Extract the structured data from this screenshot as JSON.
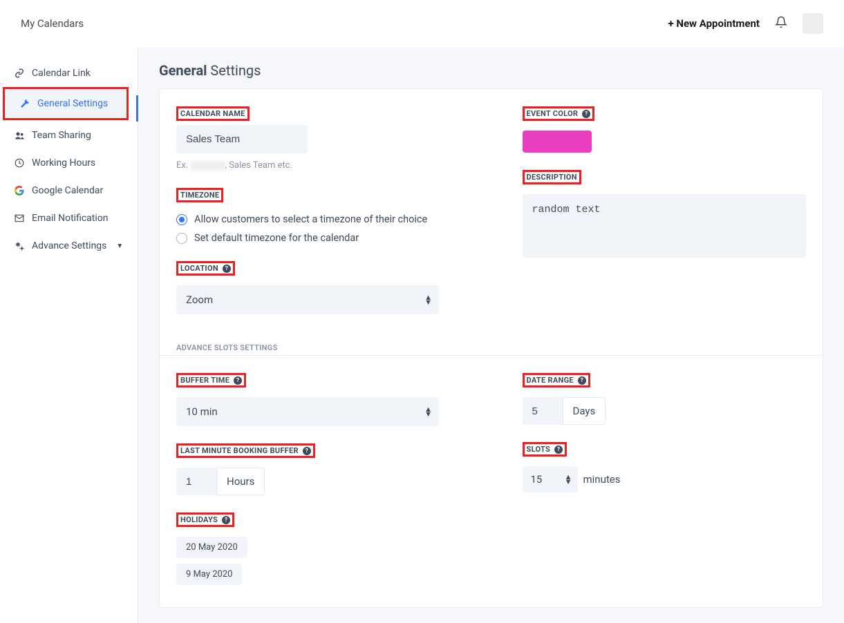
{
  "topbar": {
    "title": "My Calendars",
    "new_appointment_label": "+ New Appointment"
  },
  "sidebar": {
    "items": [
      {
        "label": "Calendar Link",
        "icon": "link-icon"
      },
      {
        "label": "General Settings",
        "icon": "wrench-icon",
        "active": true
      },
      {
        "label": "Team Sharing",
        "icon": "users-icon"
      },
      {
        "label": "Working Hours",
        "icon": "clock-icon"
      },
      {
        "label": "Google Calendar",
        "icon": "google-icon"
      },
      {
        "label": "Email Notification",
        "icon": "mail-icon"
      },
      {
        "label": "Advance Settings",
        "icon": "gears-icon",
        "has_submenu": true
      }
    ]
  },
  "page": {
    "title_strong": "General",
    "title_rest": " Settings"
  },
  "form": {
    "calendar_name": {
      "label": "CALENDAR NAME",
      "value": "Sales Team",
      "hint_prefix": "Ex. ",
      "hint_suffix": ", Sales Team etc."
    },
    "timezone": {
      "label": "TIMEZONE",
      "option_allow": "Allow customers to select a timezone of their choice",
      "option_default": "Set default timezone for the calendar",
      "selected": "allow"
    },
    "location": {
      "label": "LOCATION",
      "value": "Zoom"
    },
    "event_color": {
      "label": "EVENT COLOR",
      "value": "#e83ebf"
    },
    "description": {
      "label": "DESCRIPTION",
      "value": "random text"
    },
    "advance_header": "ADVANCE SLOTS SETTINGS",
    "buffer_time": {
      "label": "BUFFER TIME",
      "value": "10 min"
    },
    "date_range": {
      "label": "DATE RANGE",
      "value": "5",
      "unit": "Days"
    },
    "last_minute": {
      "label": "LAST MINUTE BOOKING BUFFER",
      "value": "1",
      "unit": "Hours"
    },
    "slots": {
      "label": "SLOTS",
      "value": "15",
      "unit": "minutes"
    },
    "holidays": {
      "label": "HOLIDAYS",
      "items": [
        "20 May 2020",
        "9 May 2020"
      ]
    }
  }
}
